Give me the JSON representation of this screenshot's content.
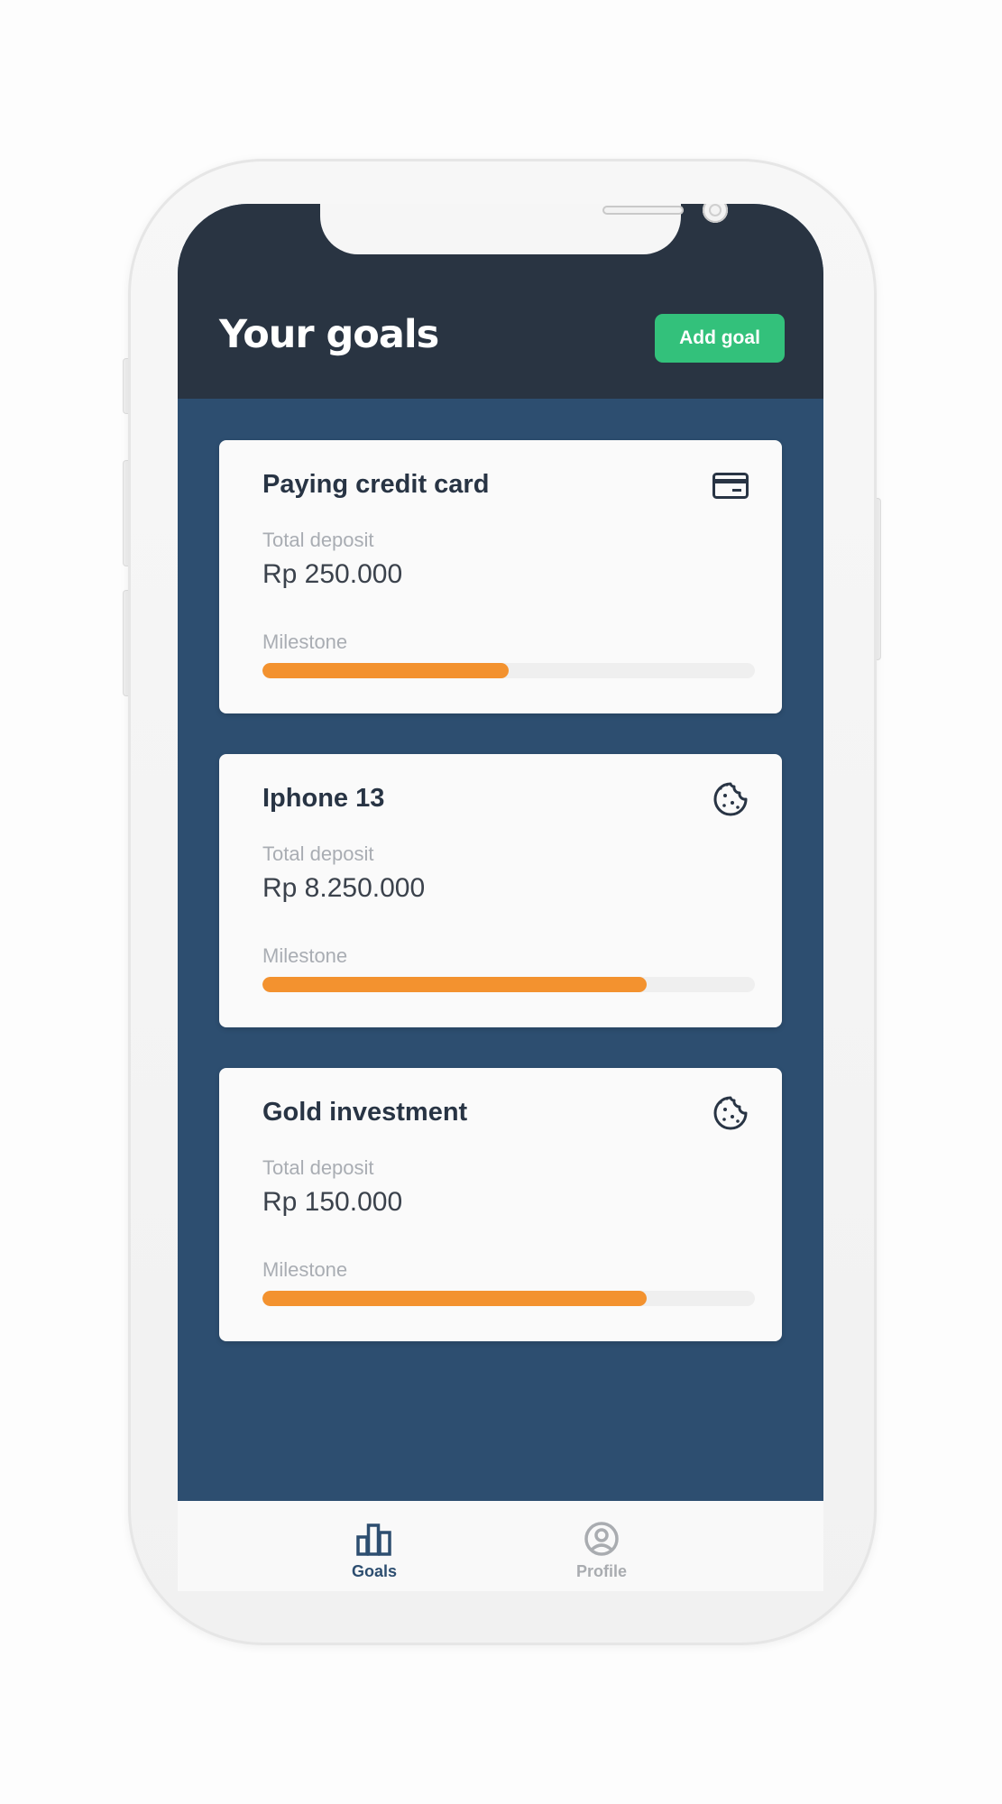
{
  "header": {
    "title": "Your goals",
    "add_goal_label": "Add goal"
  },
  "goals": [
    {
      "title": "Paying credit card",
      "icon": "credit-card-icon",
      "deposit_label": "Total deposit",
      "deposit_amount": "Rp 250.000",
      "milestone_label": "Milestone",
      "progress": 0.5
    },
    {
      "title": "Iphone 13",
      "icon": "cookie-icon",
      "deposit_label": "Total deposit",
      "deposit_amount": "Rp 8.250.000",
      "milestone_label": "Milestone",
      "progress": 0.78
    },
    {
      "title": "Gold investment",
      "icon": "cookie-icon",
      "deposit_label": "Total deposit",
      "deposit_amount": "Rp 150.000",
      "milestone_label": "Milestone",
      "progress": 0.78
    }
  ],
  "bottom_nav": {
    "items": [
      {
        "label": "Goals",
        "icon": "bar-chart-icon",
        "active": true
      },
      {
        "label": "Profile",
        "icon": "user-circle-icon",
        "active": false
      }
    ]
  },
  "colors": {
    "header_bg": "#293442",
    "screen_bg": "#2d4e70",
    "accent_green": "#33c17b",
    "progress_orange": "#f3922f",
    "nav_active": "#2d4e70",
    "nav_inactive": "#a9acb0"
  }
}
